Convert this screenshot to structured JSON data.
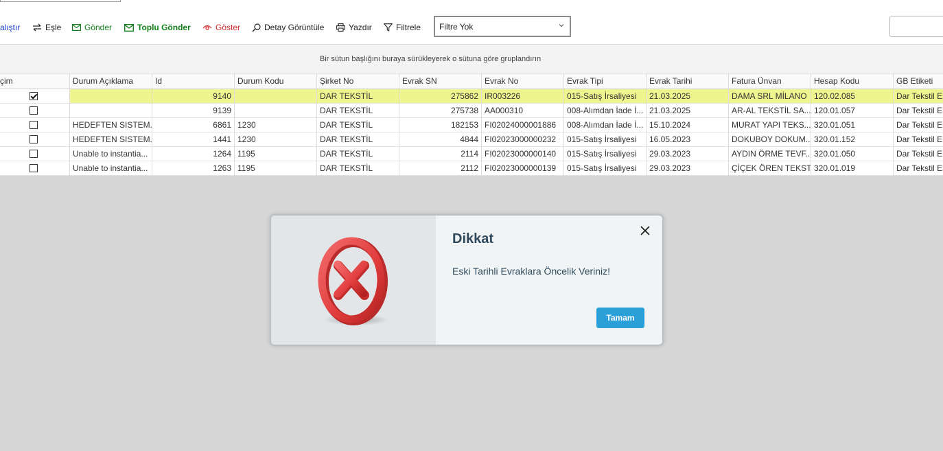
{
  "toolbar": {
    "run_label": "alıştır",
    "match_label": "Eşle",
    "send_label": "Gönder",
    "bulk_send_label": "Toplu Gönder",
    "show_label": "Göster",
    "detail_label": "Detay Görüntüle",
    "print_label": "Yazdır",
    "filter_label": "Filtrele",
    "filter_select_value": "Filtre Yok",
    "colors": {
      "run": "#1a3bd6",
      "send": "#13801b",
      "show": "#d42a2a"
    }
  },
  "group_panel": {
    "text": "Bir sütun başlığını buraya sürükleyerek o sütuna göre gruplandırın"
  },
  "grid": {
    "columns": [
      "çim",
      "Durum Açıklama",
      "Id",
      "Durum Kodu",
      "Şirket No",
      "Evrak SN",
      "Evrak No",
      "Evrak Tipi",
      "Evrak Tarihi",
      "Fatura Ünvan",
      "Hesap Kodu",
      "GB Etiketi"
    ],
    "rows": [
      {
        "checked": true,
        "durum_aciklama": "",
        "id": "9140",
        "durum_kodu": "",
        "sirket_no": "DAR TEKSTİL",
        "evrak_sn": "275862",
        "evrak_no": "IR003226",
        "evrak_tipi": "015-Satış İrsaliyesi",
        "evrak_tarihi": "21.03.2025",
        "fatura_unvan": "DAMA SRL MİLANO",
        "hesap_kodu": "120.02.085",
        "gb_etiketi": "Dar Tekstil El"
      },
      {
        "checked": false,
        "durum_aciklama": "",
        "id": "9139",
        "durum_kodu": "",
        "sirket_no": "DAR TEKSTİL",
        "evrak_sn": "275738",
        "evrak_no": "AA000310",
        "evrak_tipi": "008-Alımdan İade İ...",
        "evrak_tarihi": "21.03.2025",
        "fatura_unvan": "AR-AL TEKSTİL SA...",
        "hesap_kodu": "120.01.057",
        "gb_etiketi": "Dar Tekstil El"
      },
      {
        "checked": false,
        "durum_aciklama": "HEDEFTEN SISTEM...",
        "id": "6861",
        "durum_kodu": "1230",
        "sirket_no": "DAR TEKSTİL",
        "evrak_sn": "182153",
        "evrak_no": "FI02024000001886",
        "evrak_tipi": "008-Alımdan İade İ...",
        "evrak_tarihi": "15.10.2024",
        "fatura_unvan": "MURAT YAPI TEKS...",
        "hesap_kodu": "320.01.051",
        "gb_etiketi": "Dar Tekstil El"
      },
      {
        "checked": false,
        "durum_aciklama": "HEDEFTEN SISTEM...",
        "id": "1441",
        "durum_kodu": "1230",
        "sirket_no": "DAR TEKSTİL",
        "evrak_sn": "4844",
        "evrak_no": "FI02023000000232",
        "evrak_tipi": "015-Satış İrsaliyesi",
        "evrak_tarihi": "16.05.2023",
        "fatura_unvan": "DOKUBOY DOKUM...",
        "hesap_kodu": "320.01.152",
        "gb_etiketi": "Dar Tekstil El"
      },
      {
        "checked": false,
        "durum_aciklama": "Unable to instantia...",
        "id": "1264",
        "durum_kodu": "1195",
        "sirket_no": "DAR TEKSTİL",
        "evrak_sn": "2114",
        "evrak_no": "FI02023000000140",
        "evrak_tipi": "015-Satış İrsaliyesi",
        "evrak_tarihi": "29.03.2023",
        "fatura_unvan": "AYDIN ÖRME TEVF...",
        "hesap_kodu": "320.01.050",
        "gb_etiketi": "Dar Tekstil El"
      },
      {
        "checked": false,
        "durum_aciklama": "Unable to instantia...",
        "id": "1263",
        "durum_kodu": "1195",
        "sirket_no": "DAR TEKSTİL",
        "evrak_sn": "2112",
        "evrak_no": "FI02023000000139",
        "evrak_tipi": "015-Satış İrsaliyesi",
        "evrak_tarihi": "29.03.2023",
        "fatura_unvan": "ÇİÇEK ÖREN TEKST...",
        "hesap_kodu": "320.01.019",
        "gb_etiketi": "Dar Tekstil El"
      }
    ],
    "selected_row_color": "#eef58e"
  },
  "dialog": {
    "title": "Dikkat",
    "message": "Eski Tarihli Evraklara Öncelik Veriniz!",
    "ok_label": "Tamam",
    "icon": "error-x-icon",
    "ok_color": "#2a9fd8"
  }
}
